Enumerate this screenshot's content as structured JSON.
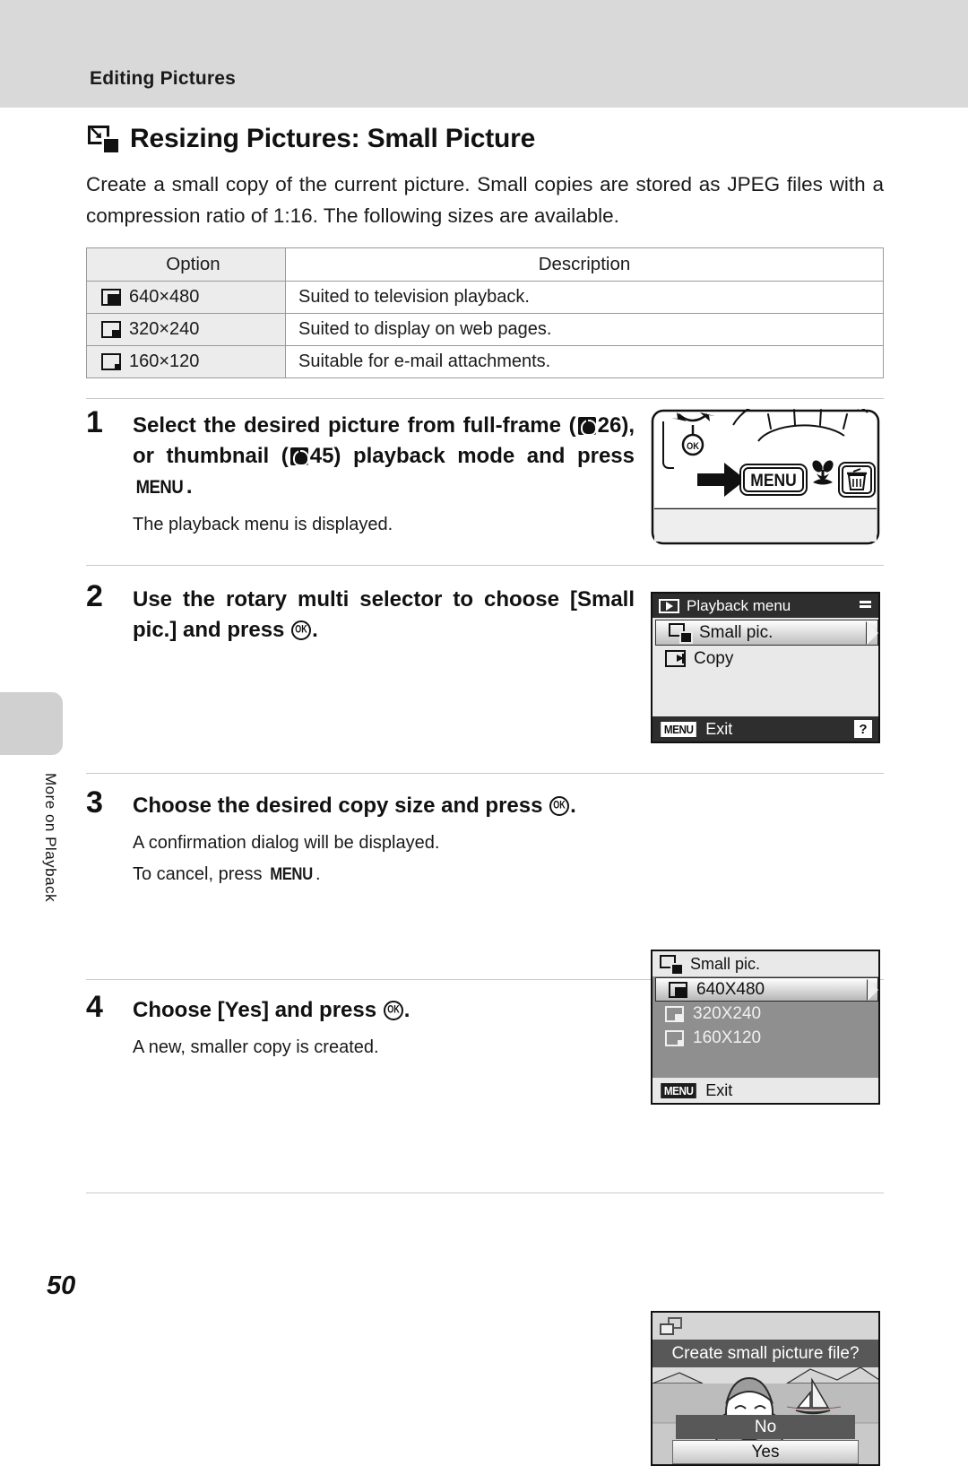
{
  "header": {
    "section_title": "Editing Pictures"
  },
  "side_tab": {
    "label": "More on Playback"
  },
  "title": {
    "text": "Resizing Pictures: Small Picture",
    "icon": "resize-icon"
  },
  "intro": "Create a small copy of the current picture. Small copies are stored as JPEG files with a compression ratio of 1:16. The following sizes are available.",
  "table": {
    "headers": [
      "Option",
      "Description"
    ],
    "rows": [
      {
        "icon": "size-large-icon",
        "option": "640×480",
        "description": "Suited to television playback."
      },
      {
        "icon": "size-medium-icon",
        "option": "320×240",
        "description": "Suited to display on web pages."
      },
      {
        "icon": "size-small-icon",
        "option": "160×120",
        "description": "Suitable for e-mail attachments."
      }
    ]
  },
  "steps": [
    {
      "number": "1",
      "main_a": "Select the desired picture from full-frame (",
      "ref1": "26",
      "main_b": "), or thumbnail (",
      "ref2": "45",
      "main_c": ") playback mode and press ",
      "menu_word": "MENU",
      "main_d": ".",
      "sub": "The playback menu is displayed."
    },
    {
      "number": "2",
      "main_a": "Use the rotary multi selector to choose [Small pic.] and press ",
      "main_d": "."
    },
    {
      "number": "3",
      "main_a": "Choose the desired copy size and press ",
      "main_d": ".",
      "sub": "A confirmation dialog will be displayed.",
      "sub2_a": "To cancel, press ",
      "menu_word": "MENU",
      "sub2_b": "."
    },
    {
      "number": "4",
      "main_a": "Choose [Yes] and press ",
      "main_d": ".",
      "sub": "A new, smaller copy is created."
    }
  ],
  "camera_illustration": {
    "menu_button_label": "MENU",
    "ok_button_label": "OK",
    "trash_icon": "trash-icon",
    "macro_icon": "flower-macro-icon",
    "arrow_icon": "right-arrow-icon"
  },
  "screen_playback_menu": {
    "title": "Playback menu",
    "title_icon": "play-icon",
    "items": [
      {
        "icon": "small-picture-icon",
        "label": "Small pic.",
        "selected": true
      },
      {
        "icon": "copy-icon",
        "label": "Copy",
        "selected": false
      }
    ],
    "footer_badge": "MENU",
    "footer_label": "Exit",
    "help_badge": "?"
  },
  "screen_small_pic": {
    "title": "Small pic.",
    "title_icon": "small-picture-icon",
    "items": [
      {
        "icon": "size-large-icon",
        "label": "640X480",
        "selected": true
      },
      {
        "icon": "size-medium-icon",
        "label": "320X240",
        "selected": false
      },
      {
        "icon": "size-small-icon",
        "label": "160X120",
        "selected": false
      }
    ],
    "footer_badge": "MENU",
    "footer_label": "Exit"
  },
  "screen_confirm": {
    "icon": "small-picture-icon",
    "question": "Create small picture file?",
    "button_no": "No",
    "button_yes": "Yes",
    "selected_button": "Yes"
  },
  "page_number": "50",
  "colors": {
    "header_gray": "#d9d9d9",
    "lcd_dark": "#2e2e2e",
    "lcd_body": "#e9e9e9",
    "lcd_list_gray": "#8f8f8f",
    "text": "#111111"
  }
}
